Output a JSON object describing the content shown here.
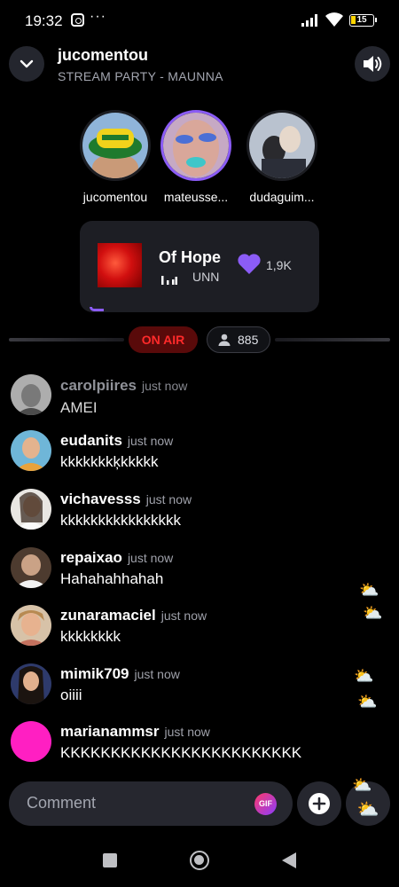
{
  "status_bar": {
    "time": "19:32",
    "more": "···",
    "battery": "15"
  },
  "header": {
    "title": "jucomentou",
    "subtitle": "STREAM PARTY - MAUNNA"
  },
  "listeners": [
    {
      "name": "jucomentou",
      "active": false
    },
    {
      "name": "mateusse...",
      "active": true
    },
    {
      "name": "dudaguim...",
      "active": false
    }
  ],
  "now_playing": {
    "song": "Of Hope",
    "artist": "UNN",
    "likes": "1,9K"
  },
  "live": {
    "badge": "ON AIR",
    "viewers": "885"
  },
  "comments": [
    {
      "user": "carolpiires",
      "time": "just now",
      "text": "AMEI"
    },
    {
      "user": "eudanits",
      "time": "just now",
      "text": "kkkkkkkķkkkkk"
    },
    {
      "user": "vichavesss",
      "time": "just now",
      "text": "kkkkkkkkkkkkkkkk"
    },
    {
      "user": "repaixao",
      "time": "just now",
      "text": "Hahahahhahah"
    },
    {
      "user": "zunaramaciel",
      "time": "just now",
      "text": "kkkkkkkk"
    },
    {
      "user": "mimik709",
      "time": "just now",
      "text": "oiiii"
    },
    {
      "user": "marianammsr",
      "time": "just now",
      "text": "KKKKKKKKKKKKKKKKKKKKKKKK"
    }
  ],
  "reactions": {
    "icon": "sun-behind-cloud",
    "glyph": "⛅"
  },
  "composer": {
    "placeholder": "Comment",
    "gif_label": "GIF"
  },
  "colors": {
    "accent": "#8b5cf6",
    "on_air": "#ff2a2a",
    "background": "#000000"
  }
}
